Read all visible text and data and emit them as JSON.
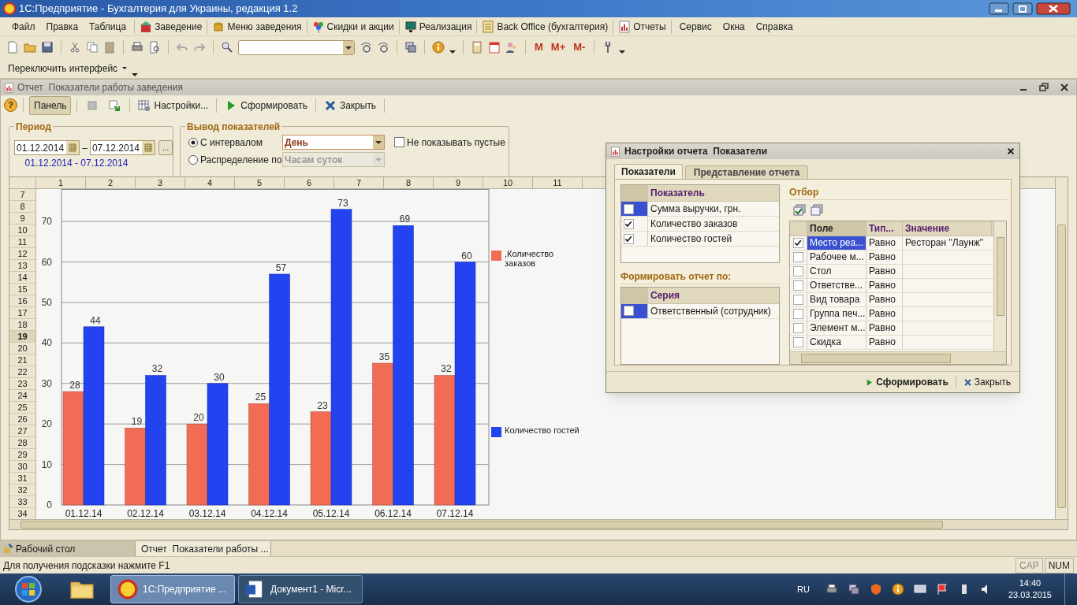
{
  "window": {
    "title": "1С:Предприятие - Бухгалтерия для Украины, редакция 1.2"
  },
  "menu": [
    {
      "label": "Файл",
      "kind": "plain"
    },
    {
      "label": "Правка",
      "kind": "plain"
    },
    {
      "label": "Таблица",
      "kind": "plain"
    },
    {
      "label": "Заведение",
      "kind": "with_icon"
    },
    {
      "label": "Меню заведения",
      "kind": "with_icon"
    },
    {
      "label": "Скидки и акции",
      "kind": "with_icon"
    },
    {
      "label": "Реализация",
      "kind": "with_icon"
    },
    {
      "label": "Back Office (бухгалтерия)",
      "kind": "with_icon"
    },
    {
      "label": "Отчеты",
      "kind": "with_icon"
    },
    {
      "label": "Сервис",
      "kind": "plain"
    },
    {
      "label": "Окна",
      "kind": "plain"
    },
    {
      "label": "Справка",
      "kind": "plain"
    }
  ],
  "toolbar": {
    "memory_buttons": [
      "M",
      "M+",
      "M-"
    ]
  },
  "interface_switch": {
    "label": "Переключить интерфейс"
  },
  "report": {
    "title": "Отчет  Показатели работы заведения",
    "toolbar": {
      "help": "?",
      "panel": {
        "label": "Панель",
        "selected": true
      },
      "settings": "Настройки...",
      "run": "Сформировать",
      "close": "Закрыть"
    },
    "period": {
      "legend": "Период",
      "date_from": "01.12.2014",
      "dash": "–",
      "date_to": "07.12.2014",
      "more": "...",
      "summary": "01.12.2014 - 07.12.2014"
    },
    "output": {
      "legend": "Вывод показателей",
      "options": [
        {
          "label": "С интервалом",
          "selected": true,
          "value": "День",
          "disabled": false
        },
        {
          "label": "Распределение по",
          "selected": false,
          "value": "Часам суток",
          "disabled": true
        }
      ],
      "hide_empty": {
        "label": "Не показывать пустые",
        "checked": false
      }
    },
    "sheet": {
      "columns": [
        "1",
        "2",
        "3",
        "4",
        "5",
        "6",
        "7",
        "8",
        "9",
        "10",
        "11"
      ],
      "rows": [
        {
          "label": "7",
          "selected": false
        },
        {
          "label": "8",
          "selected": false
        },
        {
          "label": "9",
          "selected": false
        },
        {
          "label": "10",
          "selected": false
        },
        {
          "label": "11",
          "selected": false
        },
        {
          "label": "12",
          "selected": false
        },
        {
          "label": "13",
          "selected": false
        },
        {
          "label": "14",
          "selected": false
        },
        {
          "label": "15",
          "selected": false
        },
        {
          "label": "16",
          "selected": false
        },
        {
          "label": "17",
          "selected": false
        },
        {
          "label": "18",
          "selected": false
        },
        {
          "label": "19",
          "selected": true
        },
        {
          "label": "20",
          "selected": false
        },
        {
          "label": "21",
          "selected": false
        },
        {
          "label": "22",
          "selected": false
        },
        {
          "label": "23",
          "selected": false
        },
        {
          "label": "24",
          "selected": false
        },
        {
          "label": "25",
          "selected": false
        },
        {
          "label": "26",
          "selected": false
        },
        {
          "label": "27",
          "selected": false
        },
        {
          "label": "28",
          "selected": false
        },
        {
          "label": "29",
          "selected": false
        },
        {
          "label": "30",
          "selected": false
        },
        {
          "label": "31",
          "selected": false
        },
        {
          "label": "32",
          "selected": false
        },
        {
          "label": "33",
          "selected": false
        },
        {
          "label": "34",
          "selected": false
        }
      ]
    },
    "chart": {
      "chart_data": {
        "type": "bar",
        "categories": [
          "01.12.14",
          "02.12.14",
          "03.12.14",
          "04.12.14",
          "05.12.14",
          "06.12.14",
          "07.12.14"
        ],
        "series": [
          {
            "name": ",Количество заказов",
            "color": "#f26b55",
            "values": [
              28,
              19,
              20,
              25,
              23,
              35,
              32
            ]
          },
          {
            "name": "Количество гостей",
            "color": "#2342f0",
            "values": [
              44,
              32,
              30,
              57,
              73,
              69,
              60
            ]
          }
        ],
        "ylim": [
          0,
          78
        ],
        "yticks": [
          0,
          10,
          20,
          30,
          40,
          50,
          60,
          70
        ],
        "grid": true,
        "legend": "right",
        "data_labels": true
      }
    }
  },
  "dialog": {
    "title": "Настройки отчета  Показатели",
    "tabs": [
      {
        "label": "Показатели",
        "selected": true
      },
      {
        "label": "Представление отчета",
        "selected": false
      }
    ],
    "indicators": {
      "header": "Показатель",
      "rows": [
        {
          "label": "Сумма выручки, грн.",
          "checked": false,
          "selected": true
        },
        {
          "label": "Количество заказов",
          "checked": true,
          "selected": false
        },
        {
          "label": "Количество гостей",
          "checked": true,
          "selected": false
        }
      ]
    },
    "group_by": {
      "title": "Формировать отчет по:",
      "header": "Серия",
      "rows": [
        {
          "label": "Ответственный (сотрудник)",
          "checked": false,
          "selected": true
        }
      ]
    },
    "filter": {
      "title": "Отбор",
      "columns": [
        "Поле",
        "Тип...",
        "Значение"
      ],
      "rows": [
        {
          "field": "Место реа...",
          "type": "Равно",
          "value": "Ресторан \"Лаунж\"",
          "checked": true,
          "selected": true
        },
        {
          "field": "Рабочее м...",
          "type": "Равно",
          "checked": false,
          "selected": false
        },
        {
          "field": "Стол",
          "type": "Равно",
          "checked": false,
          "selected": false
        },
        {
          "field": "Ответстве...",
          "type": "Равно",
          "checked": false,
          "selected": false
        },
        {
          "field": "Вид товара",
          "type": "Равно",
          "checked": false,
          "selected": false
        },
        {
          "field": "Группа печ...",
          "type": "Равно",
          "checked": false,
          "selected": false
        },
        {
          "field": "Элемент м...",
          "type": "Равно",
          "checked": false,
          "selected": false
        },
        {
          "field": "Скидка",
          "type": "Равно",
          "checked": false,
          "selected": false
        }
      ]
    },
    "buttons": [
      {
        "label": "Сформировать",
        "kind": "run"
      },
      {
        "label": "Закрыть",
        "kind": "close"
      }
    ]
  },
  "window_tabs": [
    {
      "label": "Рабочий стол",
      "selected": false
    },
    {
      "label": "Отчет  Показатели работы ...",
      "selected": true
    }
  ],
  "status_bar": {
    "hint": "Для получения подсказки нажмите F1",
    "indicators": [
      {
        "label": "CAP",
        "on": false
      },
      {
        "label": "NUM",
        "on": true
      }
    ]
  },
  "taskbar": {
    "tasks": [
      {
        "label": "1С:Предприятие ...",
        "selected": true
      },
      {
        "label": "Документ1 - Micr...",
        "selected": false
      }
    ],
    "language": "RU",
    "time": "14:40",
    "date": "23.03.2015"
  }
}
